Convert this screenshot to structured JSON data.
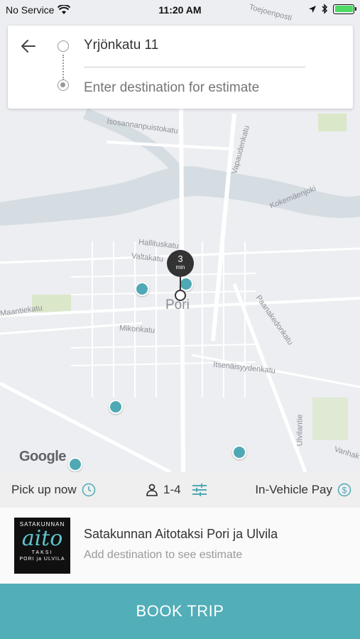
{
  "status_bar": {
    "carrier": "No Service",
    "time": "11:20 AM",
    "battery_level": 1.0
  },
  "trip": {
    "origin": "Yrjönkatu 11",
    "destination_placeholder": "Enter destination for estimate",
    "back_icon": "arrow-left-icon"
  },
  "map": {
    "city": "Pori",
    "streets": [
      "Toejoenposti",
      "Isosannanpuistokatu",
      "Valtakatu",
      "Hallituskatu",
      "Maantiekatu",
      "Mikonkatu",
      "Itsenäisyydenkatu",
      "Paanakedonkatu",
      "Ulvilantie",
      "Vanhak",
      "Kokemäenjoki",
      "Vapaudenkatu"
    ],
    "eta": {
      "value": "3",
      "unit": "min"
    },
    "attribution": "Google",
    "taxi_count": 5
  },
  "options": {
    "pickup_label": "Pick up now",
    "passengers_label": "1-4",
    "payment_label": "In-Vehicle Pay",
    "icons": [
      "clock-icon",
      "person-icon",
      "sliders-icon",
      "dollar-icon"
    ]
  },
  "company": {
    "name": "Satakunnan Aitotaksi Pori ja Ulvila",
    "estimate_text": "Add destination to see estimate",
    "logo": {
      "top": "SATAKUNNAN",
      "main": "aito",
      "sub": "TAKSI",
      "bottom": "PORI ja ULVILA"
    }
  },
  "book_button": {
    "label": "BOOK TRIP"
  },
  "colors": {
    "accent": "#52aeb8",
    "taxi": "#4fa9b5",
    "map_bg": "#eceef1",
    "river": "#d5dde3"
  }
}
